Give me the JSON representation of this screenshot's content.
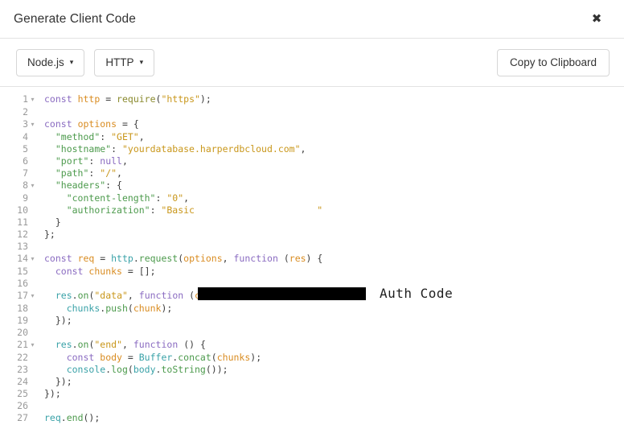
{
  "header": {
    "title": "Generate Client Code",
    "close_label": "✖"
  },
  "toolbar": {
    "language_dropdown": "Node.js",
    "client_dropdown": "HTTP",
    "copy_label": "Copy to Clipboard",
    "caret": "▾"
  },
  "annotation": {
    "auth_code_label": "Auth Code"
  },
  "colors": {
    "keyword": "#8a6bc1",
    "variable": "#d98c21",
    "entity": "#3aa2a8",
    "function": "#4c9a4c",
    "string": "#c9971b",
    "gutter": "#9a9a9a",
    "border": "#e3e3e3",
    "redaction": "#000000"
  },
  "code": {
    "language": "javascript",
    "fold_arrow": "▾",
    "lines": [
      {
        "n": "1",
        "fold": true,
        "tokens": [
          {
            "t": "kw",
            "v": "const"
          },
          {
            "t": "plain",
            "v": " "
          },
          {
            "t": "var",
            "v": "http"
          },
          {
            "t": "plain",
            "v": " = "
          },
          {
            "t": "build",
            "v": "require"
          },
          {
            "t": "punct",
            "v": "("
          },
          {
            "t": "str",
            "v": "\"https\""
          },
          {
            "t": "punct",
            "v": ");"
          }
        ]
      },
      {
        "n": "2",
        "fold": false,
        "tokens": []
      },
      {
        "n": "3",
        "fold": true,
        "tokens": [
          {
            "t": "kw",
            "v": "const"
          },
          {
            "t": "plain",
            "v": " "
          },
          {
            "t": "var",
            "v": "options"
          },
          {
            "t": "plain",
            "v": " = "
          },
          {
            "t": "punct",
            "v": "{"
          }
        ]
      },
      {
        "n": "4",
        "fold": false,
        "tokens": [
          {
            "t": "plain",
            "v": "  "
          },
          {
            "t": "key",
            "v": "\"method\""
          },
          {
            "t": "punct",
            "v": ": "
          },
          {
            "t": "str",
            "v": "\"GET\""
          },
          {
            "t": "punct",
            "v": ","
          }
        ]
      },
      {
        "n": "5",
        "fold": false,
        "tokens": [
          {
            "t": "plain",
            "v": "  "
          },
          {
            "t": "key",
            "v": "\"hostname\""
          },
          {
            "t": "punct",
            "v": ": "
          },
          {
            "t": "str",
            "v": "\"yourdatabase.harperdbcloud.com\""
          },
          {
            "t": "punct",
            "v": ","
          }
        ]
      },
      {
        "n": "6",
        "fold": false,
        "tokens": [
          {
            "t": "plain",
            "v": "  "
          },
          {
            "t": "key",
            "v": "\"port\""
          },
          {
            "t": "punct",
            "v": ": "
          },
          {
            "t": "kw",
            "v": "null"
          },
          {
            "t": "punct",
            "v": ","
          }
        ]
      },
      {
        "n": "7",
        "fold": false,
        "tokens": [
          {
            "t": "plain",
            "v": "  "
          },
          {
            "t": "key",
            "v": "\"path\""
          },
          {
            "t": "punct",
            "v": ": "
          },
          {
            "t": "str",
            "v": "\"/\""
          },
          {
            "t": "punct",
            "v": ","
          }
        ]
      },
      {
        "n": "8",
        "fold": true,
        "tokens": [
          {
            "t": "plain",
            "v": "  "
          },
          {
            "t": "key",
            "v": "\"headers\""
          },
          {
            "t": "punct",
            "v": ": "
          },
          {
            "t": "punct",
            "v": "{"
          }
        ]
      },
      {
        "n": "9",
        "fold": false,
        "tokens": [
          {
            "t": "plain",
            "v": "    "
          },
          {
            "t": "key",
            "v": "\"content-length\""
          },
          {
            "t": "punct",
            "v": ": "
          },
          {
            "t": "str",
            "v": "\"0\""
          },
          {
            "t": "punct",
            "v": ","
          }
        ]
      },
      {
        "n": "10",
        "fold": false,
        "tokens": [
          {
            "t": "plain",
            "v": "    "
          },
          {
            "t": "key",
            "v": "\"authorization\""
          },
          {
            "t": "punct",
            "v": ": "
          },
          {
            "t": "str",
            "v": "\"Basic "
          },
          {
            "t": "redacted",
            "v": "                     "
          },
          {
            "t": "str",
            "v": "\""
          }
        ]
      },
      {
        "n": "11",
        "fold": false,
        "tokens": [
          {
            "t": "plain",
            "v": "  "
          },
          {
            "t": "punct",
            "v": "}"
          }
        ]
      },
      {
        "n": "12",
        "fold": false,
        "tokens": [
          {
            "t": "punct",
            "v": "};"
          }
        ]
      },
      {
        "n": "13",
        "fold": false,
        "tokens": []
      },
      {
        "n": "14",
        "fold": true,
        "tokens": [
          {
            "t": "kw",
            "v": "const"
          },
          {
            "t": "plain",
            "v": " "
          },
          {
            "t": "var",
            "v": "req"
          },
          {
            "t": "plain",
            "v": " = "
          },
          {
            "t": "ent",
            "v": "http"
          },
          {
            "t": "punct",
            "v": "."
          },
          {
            "t": "fn",
            "v": "request"
          },
          {
            "t": "punct",
            "v": "("
          },
          {
            "t": "var",
            "v": "options"
          },
          {
            "t": "punct",
            "v": ", "
          },
          {
            "t": "kw",
            "v": "function"
          },
          {
            "t": "plain",
            "v": " "
          },
          {
            "t": "punct",
            "v": "("
          },
          {
            "t": "var",
            "v": "res"
          },
          {
            "t": "punct",
            "v": ") {"
          }
        ]
      },
      {
        "n": "15",
        "fold": false,
        "tokens": [
          {
            "t": "plain",
            "v": "  "
          },
          {
            "t": "kw",
            "v": "const"
          },
          {
            "t": "plain",
            "v": " "
          },
          {
            "t": "var",
            "v": "chunks"
          },
          {
            "t": "plain",
            "v": " = "
          },
          {
            "t": "punct",
            "v": "[];"
          }
        ]
      },
      {
        "n": "16",
        "fold": false,
        "tokens": []
      },
      {
        "n": "17",
        "fold": true,
        "tokens": [
          {
            "t": "plain",
            "v": "  "
          },
          {
            "t": "ent",
            "v": "res"
          },
          {
            "t": "punct",
            "v": "."
          },
          {
            "t": "fn",
            "v": "on"
          },
          {
            "t": "punct",
            "v": "("
          },
          {
            "t": "str",
            "v": "\"data\""
          },
          {
            "t": "punct",
            "v": ", "
          },
          {
            "t": "kw",
            "v": "function"
          },
          {
            "t": "plain",
            "v": " "
          },
          {
            "t": "punct",
            "v": "("
          },
          {
            "t": "var",
            "v": "chunk"
          },
          {
            "t": "punct",
            "v": ") {"
          }
        ]
      },
      {
        "n": "18",
        "fold": false,
        "tokens": [
          {
            "t": "plain",
            "v": "    "
          },
          {
            "t": "ent",
            "v": "chunks"
          },
          {
            "t": "punct",
            "v": "."
          },
          {
            "t": "fn",
            "v": "push"
          },
          {
            "t": "punct",
            "v": "("
          },
          {
            "t": "var",
            "v": "chunk"
          },
          {
            "t": "punct",
            "v": ");"
          }
        ]
      },
      {
        "n": "19",
        "fold": false,
        "tokens": [
          {
            "t": "plain",
            "v": "  "
          },
          {
            "t": "punct",
            "v": "});"
          }
        ]
      },
      {
        "n": "20",
        "fold": false,
        "tokens": []
      },
      {
        "n": "21",
        "fold": true,
        "tokens": [
          {
            "t": "plain",
            "v": "  "
          },
          {
            "t": "ent",
            "v": "res"
          },
          {
            "t": "punct",
            "v": "."
          },
          {
            "t": "fn",
            "v": "on"
          },
          {
            "t": "punct",
            "v": "("
          },
          {
            "t": "str",
            "v": "\"end\""
          },
          {
            "t": "punct",
            "v": ", "
          },
          {
            "t": "kw",
            "v": "function"
          },
          {
            "t": "plain",
            "v": " "
          },
          {
            "t": "punct",
            "v": "() {"
          }
        ]
      },
      {
        "n": "22",
        "fold": false,
        "tokens": [
          {
            "t": "plain",
            "v": "    "
          },
          {
            "t": "kw",
            "v": "const"
          },
          {
            "t": "plain",
            "v": " "
          },
          {
            "t": "var",
            "v": "body"
          },
          {
            "t": "plain",
            "v": " = "
          },
          {
            "t": "ent",
            "v": "Buffer"
          },
          {
            "t": "punct",
            "v": "."
          },
          {
            "t": "fn",
            "v": "concat"
          },
          {
            "t": "punct",
            "v": "("
          },
          {
            "t": "var",
            "v": "chunks"
          },
          {
            "t": "punct",
            "v": ");"
          }
        ]
      },
      {
        "n": "23",
        "fold": false,
        "tokens": [
          {
            "t": "plain",
            "v": "    "
          },
          {
            "t": "ent",
            "v": "console"
          },
          {
            "t": "punct",
            "v": "."
          },
          {
            "t": "fn",
            "v": "log"
          },
          {
            "t": "punct",
            "v": "("
          },
          {
            "t": "ent",
            "v": "body"
          },
          {
            "t": "punct",
            "v": "."
          },
          {
            "t": "fn",
            "v": "toString"
          },
          {
            "t": "punct",
            "v": "());"
          }
        ]
      },
      {
        "n": "24",
        "fold": false,
        "tokens": [
          {
            "t": "plain",
            "v": "  "
          },
          {
            "t": "punct",
            "v": "});"
          }
        ]
      },
      {
        "n": "25",
        "fold": false,
        "tokens": [
          {
            "t": "punct",
            "v": "});"
          }
        ]
      },
      {
        "n": "26",
        "fold": false,
        "tokens": []
      },
      {
        "n": "27",
        "fold": false,
        "tokens": [
          {
            "t": "ent",
            "v": "req"
          },
          {
            "t": "punct",
            "v": "."
          },
          {
            "t": "fn",
            "v": "end"
          },
          {
            "t": "punct",
            "v": "();"
          }
        ]
      }
    ]
  }
}
